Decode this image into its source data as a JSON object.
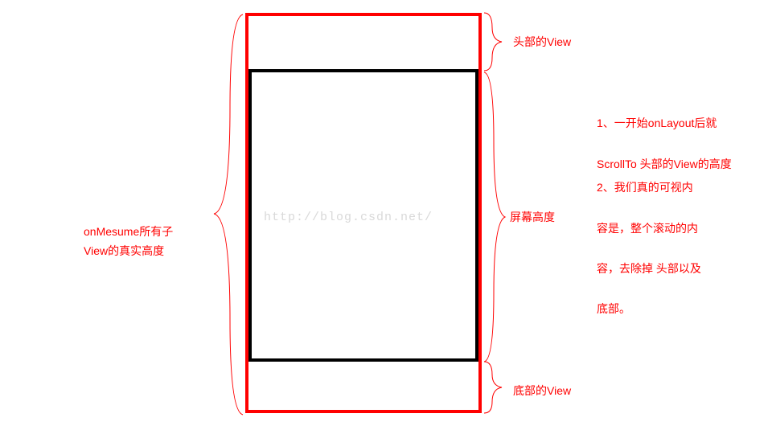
{
  "diagram": {
    "label_top": "头部的View",
    "label_screen_height": "屏幕高度",
    "label_bottom": "底部的View",
    "label_left_1": "onMesume所有子",
    "label_left_2": "View的真实高度",
    "watermark": "http://blog.csdn.net/",
    "note1_line1": "1、一开始onLayout后就",
    "note1_line2": "ScrollTo   头部的View的高度",
    "note2_line1": "2、我们真的可视内",
    "note2_line2": "容是，整个滚动的内",
    "note2_line3": "容，去除掉 头部以及",
    "note2_line4": "底部。"
  }
}
